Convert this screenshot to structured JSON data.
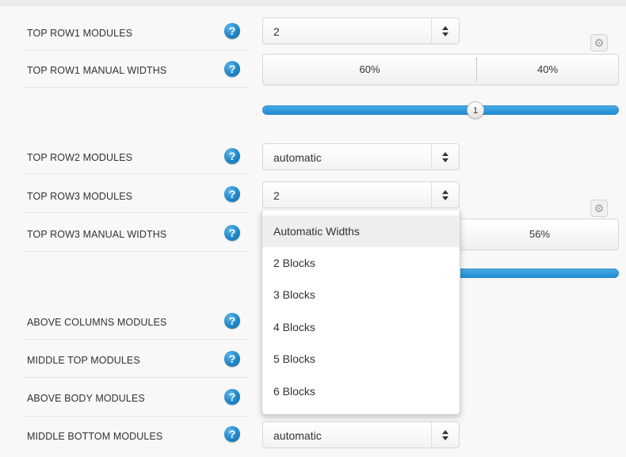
{
  "rows": [
    {
      "label": "TOP ROW1 MODULES",
      "value": "2"
    },
    {
      "label": "TOP ROW1 MANUAL WIDTHS"
    },
    {
      "label": "TOP ROW2 MODULES",
      "value": "automatic"
    },
    {
      "label": "TOP ROW3 MODULES",
      "value": "2"
    },
    {
      "label": "TOP ROW3 MANUAL WIDTHS"
    },
    {
      "label": "ABOVE COLUMNS MODULES"
    },
    {
      "label": "MIDDLE TOP MODULES"
    },
    {
      "label": "ABOVE BODY MODULES"
    },
    {
      "label": "MIDDLE BOTTOM MODULES",
      "value": "automatic"
    }
  ],
  "help_glyph": "?",
  "row1_widths": [
    "60%",
    "40%"
  ],
  "row1_slider_value": "1",
  "row3_widths": [
    "56%"
  ],
  "dropdown": {
    "options": [
      "Automatic Widths",
      "2 Blocks",
      "3 Blocks",
      "4 Blocks",
      "5 Blocks",
      "6 Blocks"
    ],
    "highlighted_index": 0
  },
  "icons": {
    "help": "question-circle-icon",
    "settings": "gear-icon",
    "select": "up-down-arrows-icon"
  },
  "colors": {
    "accent": "#1e88cf",
    "help_icon": "#1f86c8"
  }
}
